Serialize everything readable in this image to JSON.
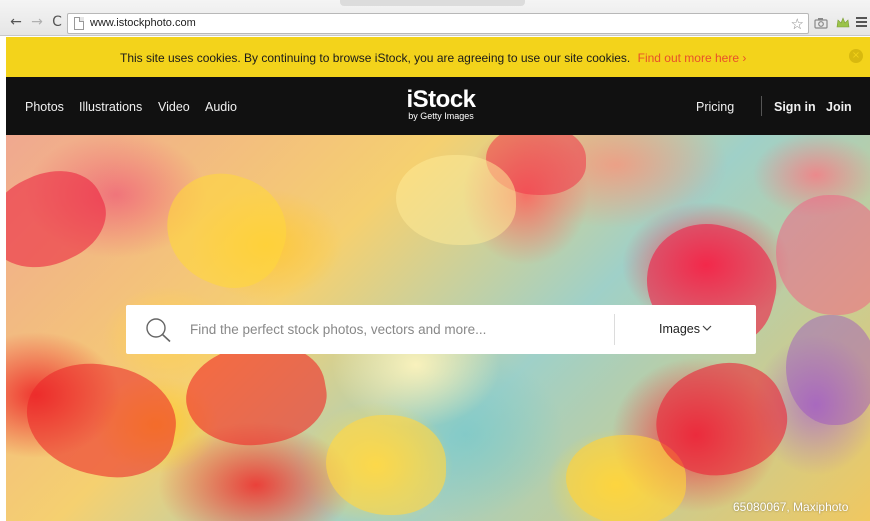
{
  "browser": {
    "url": "www.istockphoto.com"
  },
  "cookie_banner": {
    "message": "This site uses cookies. By continuing to browse iStock, you are agreeing to use our site cookies.",
    "link_label": "Find out more here ›",
    "close_symbol": "×"
  },
  "nav": {
    "left_items": [
      {
        "label": "Photos"
      },
      {
        "label": "Illustrations"
      },
      {
        "label": "Video"
      },
      {
        "label": "Audio"
      }
    ],
    "logo_main": "iStock",
    "logo_sub": "by Getty Images",
    "pricing_label": "Pricing",
    "signin_label": "Sign in",
    "join_label": "Join"
  },
  "search": {
    "placeholder": "Find the perfect stock photos, vectors and more...",
    "type_selected": "Images"
  },
  "hero": {
    "credit": "65080067, Maxiphoto"
  },
  "colors": {
    "cookie_bar": "#f3d31b",
    "cookie_link": "#e8502a",
    "nav_bg": "#111111"
  }
}
